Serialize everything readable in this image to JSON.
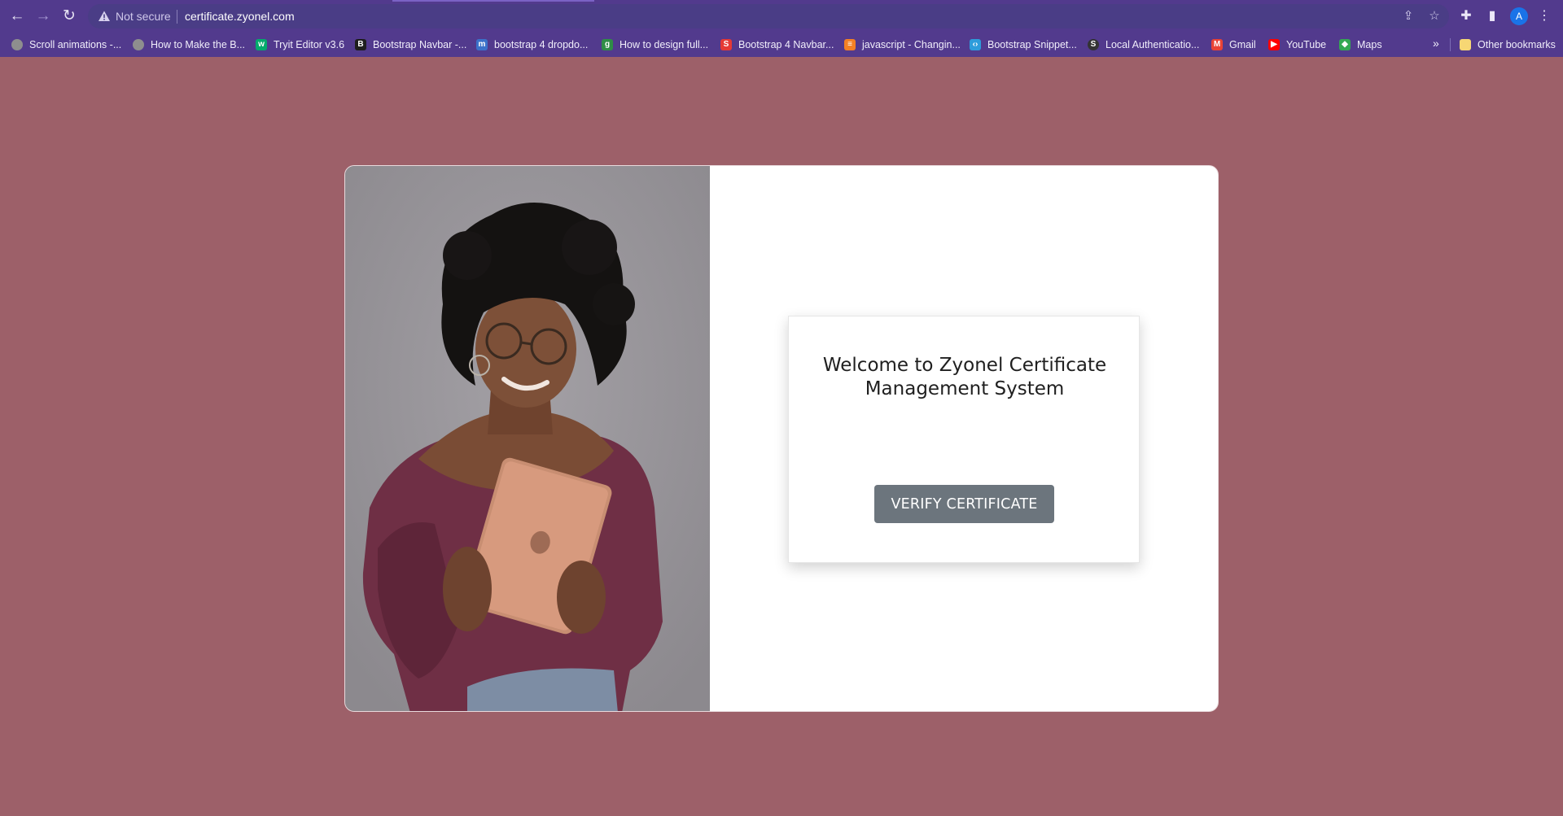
{
  "browser": {
    "security_label": "Not secure",
    "url": "certificate.zyonel.com",
    "profile_initial": "A",
    "bookmarks": [
      {
        "label": "Scroll animations -...",
        "icon": "globe-icon",
        "color": "#8e8e8e"
      },
      {
        "label": "How to Make the B...",
        "icon": "globe-icon",
        "color": "#8e8e8e"
      },
      {
        "label": "Tryit Editor v3.6",
        "icon": "w3schools-icon",
        "color": "#04aa6d"
      },
      {
        "label": "Bootstrap Navbar -...",
        "icon": "bootstrap-icon",
        "color": "#563d7c"
      },
      {
        "label": "bootstrap 4 dropdo...",
        "icon": "mdb-icon",
        "color": "#3b71ca"
      },
      {
        "label": "How to design full...",
        "icon": "gfg-icon",
        "color": "#2f8d46"
      },
      {
        "label": "Bootstrap 4 Navbar...",
        "icon": "s-icon",
        "color": "#e53935"
      },
      {
        "label": "javascript - Changin...",
        "icon": "stackoverflow-icon",
        "color": "#f48024"
      },
      {
        "label": "Bootstrap Snippet...",
        "icon": "snippet-icon",
        "color": "#2d9cdb"
      },
      {
        "label": "Local Authenticatio...",
        "icon": "local-auth-icon",
        "color": "#333333"
      },
      {
        "label": "Gmail",
        "icon": "gmail-icon",
        "color": "#ea4335"
      },
      {
        "label": "YouTube",
        "icon": "youtube-icon",
        "color": "#ff0000"
      },
      {
        "label": "Maps",
        "icon": "maps-icon",
        "color": "#34a853"
      }
    ],
    "more_label": "»",
    "other_bookmarks": "Other bookmarks"
  },
  "main": {
    "welcome_title": "Welcome to Zyonel Certificate Management System",
    "verify_button": "VERIFY CERTIFICATE"
  },
  "colors": {
    "page_background": "#9d6069",
    "browser_chrome": "#523a8d",
    "button": "#6c757d"
  }
}
